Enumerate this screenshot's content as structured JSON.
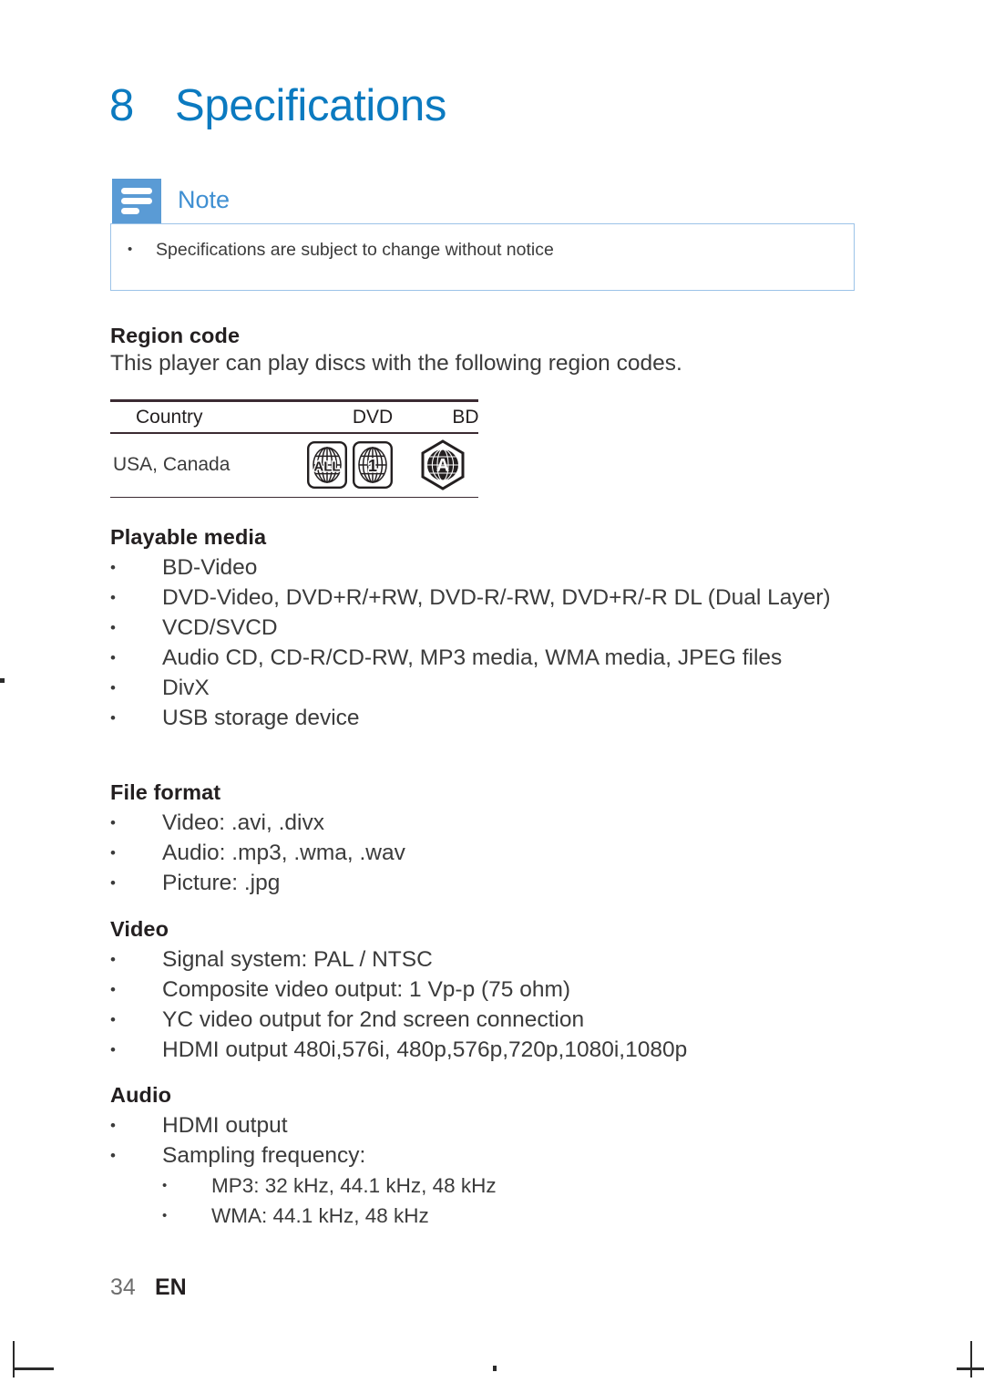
{
  "chapter": {
    "number": "8",
    "title": "Specifications"
  },
  "note": {
    "icon": "note-lines-icon",
    "label": "Note",
    "bullet_glyph": "•",
    "items": [
      "Specifications are subject to change without notice"
    ]
  },
  "sections": [
    {
      "heading": "Region code",
      "paragraph": "This player can play discs with the following region codes."
    },
    {
      "heading": "Playable media",
      "items": [
        "BD-Video",
        "DVD-Video, DVD+R/+RW, DVD-R/-RW, DVD+R/-R DL (Dual Layer)",
        "VCD/SVCD",
        "Audio CD, CD-R/CD-RW, MP3 media, WMA media, JPEG files",
        "DivX",
        "USB storage device"
      ]
    },
    {
      "heading": "File format",
      "items": [
        "Video: .avi, .divx",
        "Audio: .mp3, .wma, .wav",
        "Picture: .jpg"
      ]
    },
    {
      "heading": "Video",
      "items": [
        "Signal system: PAL / NTSC",
        "Composite video output: 1 Vp-p (75 ohm)",
        "YC video output for 2nd screen connection",
        "HDMI output 480i,576i, 480p,576p,720p,1080i,1080p"
      ]
    },
    {
      "heading": "Audio",
      "items": [
        "HDMI output",
        "Sampling frequency:"
      ],
      "subitems": [
        "MP3: 32 kHz, 44.1 kHz, 48 kHz",
        "WMA: 44.1 kHz, 48 kHz"
      ]
    }
  ],
  "region_table": {
    "columns": [
      "Country",
      "DVD",
      "BD"
    ],
    "rows": [
      {
        "country": "USA, Canada",
        "dvd_icons": [
          "dvd-region-all-icon",
          "dvd-region-1-icon"
        ],
        "dvd_labels": [
          "ALL",
          "1"
        ],
        "bd_icon": "bd-region-a-icon",
        "bd_label": "A"
      }
    ]
  },
  "footer": {
    "page_number": "34",
    "language": "EN"
  },
  "colors": {
    "heading_blue": "#0b7ac0",
    "note_icon_blue": "#5a9bd5",
    "note_label_blue": "#3f8fd2",
    "note_border_blue": "#9cc3e8",
    "body_text": "#3b3b3b",
    "rule_dark": "#3b2b32"
  }
}
